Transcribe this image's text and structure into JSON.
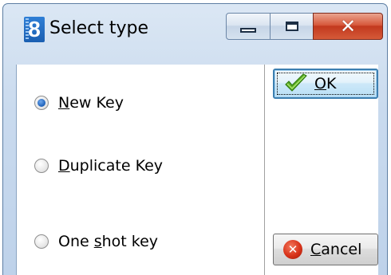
{
  "window": {
    "title": "Select type",
    "app_icon_glyph": "8",
    "app_icon_name": "app-logo-icon",
    "controls": {
      "minimize_icon": "minimize-icon",
      "maximize_icon": "maximize-icon",
      "close_icon": "close-icon",
      "close_glyph": "✕"
    },
    "colors": {
      "close_red": "#c2391e",
      "accent_blue": "#1a5fb1"
    }
  },
  "options": [
    {
      "pre": "",
      "accel": "N",
      "post": "ew Key",
      "checked": true
    },
    {
      "pre": "",
      "accel": "D",
      "post": "uplicate Key",
      "checked": false
    },
    {
      "pre": "One ",
      "accel": "s",
      "post": "hot key",
      "checked": false
    }
  ],
  "buttons": {
    "ok": {
      "accel": "O",
      "post": "K",
      "icon": "checkmark-icon"
    },
    "cancel": {
      "accel": "C",
      "post": "ancel",
      "icon": "cancel-icon",
      "glyph": "✕"
    }
  }
}
